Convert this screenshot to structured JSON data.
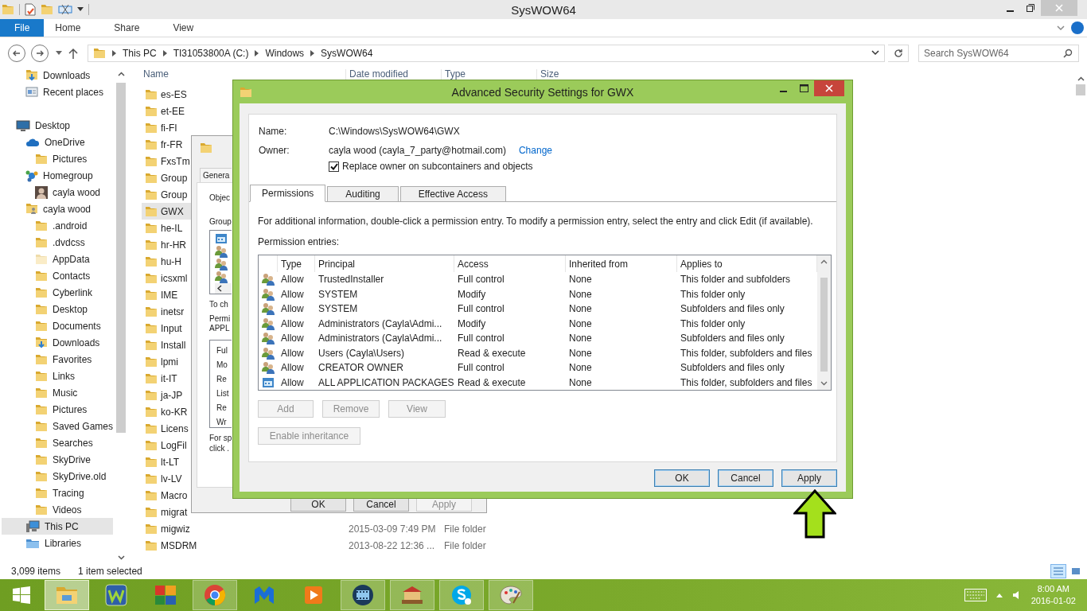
{
  "explorer": {
    "title": "SysWOW64",
    "ribbon_tabs": [
      {
        "label": "File",
        "kind": "file"
      },
      {
        "label": "Home",
        "kind": "tab"
      },
      {
        "label": "Share",
        "kind": "tab"
      },
      {
        "label": "View",
        "kind": "tab"
      }
    ],
    "breadcrumbs": [
      "This PC",
      "TI31053800A (C:)",
      "Windows",
      "SysWOW64"
    ],
    "search": {
      "placeholder": "Search SysWOW64"
    },
    "nav": {
      "pinned": [
        {
          "label": "Downloads",
          "kind": "download",
          "selected": false
        },
        {
          "label": "Recent places",
          "kind": "recent",
          "selected": false
        }
      ],
      "tree": [
        {
          "label": "Desktop",
          "kind": "desktop",
          "selected": false,
          "children": [
            {
              "label": "OneDrive",
              "kind": "cloud",
              "selected": false,
              "children": [
                {
                  "label": "Pictures",
                  "kind": "folder",
                  "selected": false
                }
              ]
            },
            {
              "label": "Homegroup",
              "kind": "homegroup",
              "selected": false,
              "children": [
                {
                  "label": "cayla wood",
                  "kind": "avatar",
                  "selected": false
                }
              ]
            },
            {
              "label": "cayla wood",
              "kind": "user",
              "selected": false,
              "children": [
                {
                  "label": ".android",
                  "kind": "folder",
                  "selected": false
                },
                {
                  "label": ".dvdcss",
                  "kind": "folder",
                  "selected": false
                },
                {
                  "label": "AppData",
                  "kind": "hidden",
                  "selected": false
                },
                {
                  "label": "Contacts",
                  "kind": "folder",
                  "selected": false
                },
                {
                  "label": "Cyberlink",
                  "kind": "folder",
                  "selected": false
                },
                {
                  "label": "Desktop",
                  "kind": "folder",
                  "selected": false
                },
                {
                  "label": "Documents",
                  "kind": "folder",
                  "selected": false
                },
                {
                  "label": "Downloads",
                  "kind": "download",
                  "selected": false
                },
                {
                  "label": "Favorites",
                  "kind": "folder",
                  "selected": false
                },
                {
                  "label": "Links",
                  "kind": "folder",
                  "selected": false
                },
                {
                  "label": "Music",
                  "kind": "folder",
                  "selected": false
                },
                {
                  "label": "Pictures",
                  "kind": "folder",
                  "selected": false
                },
                {
                  "label": "Saved Games",
                  "kind": "folder",
                  "selected": false
                },
                {
                  "label": "Searches",
                  "kind": "folder",
                  "selected": false
                },
                {
                  "label": "SkyDrive",
                  "kind": "folder",
                  "selected": false
                },
                {
                  "label": "SkyDrive.old",
                  "kind": "folder",
                  "selected": false
                },
                {
                  "label": "Tracing",
                  "kind": "folder",
                  "selected": false
                },
                {
                  "label": "Videos",
                  "kind": "folder",
                  "selected": false
                }
              ]
            },
            {
              "label": "This PC",
              "kind": "pc",
              "selected": true
            },
            {
              "label": "Libraries",
              "kind": "library",
              "selected": false
            }
          ]
        }
      ]
    },
    "columns": [
      "Name",
      "Date modified",
      "Type",
      "Size"
    ],
    "files": [
      {
        "name": "es-ES",
        "selected": false
      },
      {
        "name": "et-EE",
        "selected": false
      },
      {
        "name": "fi-FI",
        "selected": false
      },
      {
        "name": "fr-FR",
        "selected": false
      },
      {
        "name": "FxsTm",
        "selected": false
      },
      {
        "name": "Group",
        "selected": false
      },
      {
        "name": "Group",
        "selected": false
      },
      {
        "name": "GWX",
        "selected": true
      },
      {
        "name": "he-IL",
        "selected": false
      },
      {
        "name": "hr-HR",
        "selected": false
      },
      {
        "name": "hu-H",
        "selected": false
      },
      {
        "name": "icsxml",
        "selected": false
      },
      {
        "name": "IME",
        "selected": false
      },
      {
        "name": "inetsr",
        "selected": false
      },
      {
        "name": "Input",
        "selected": false
      },
      {
        "name": "Install",
        "selected": false
      },
      {
        "name": "lpmi",
        "selected": false
      },
      {
        "name": "it-IT",
        "selected": false
      },
      {
        "name": "ja-JP",
        "selected": false
      },
      {
        "name": "ko-KR",
        "selected": false
      },
      {
        "name": "Licens",
        "selected": false
      },
      {
        "name": "LogFil",
        "selected": false
      },
      {
        "name": "lt-LT",
        "selected": false
      },
      {
        "name": "lv-LV",
        "selected": false
      },
      {
        "name": "Macro",
        "selected": false
      },
      {
        "name": "migrat",
        "selected": false
      },
      {
        "name": "migwiz",
        "date": "2015-03-09 7:49 PM",
        "type": "File folder",
        "selected": false
      },
      {
        "name": "MSDRM",
        "date": "2013-08-22 12:36 ...",
        "type": "File folder",
        "selected": false
      }
    ],
    "status": {
      "count": "3,099 items",
      "selection": "1 item selected"
    }
  },
  "properties_dialog": {
    "tab": "Genera",
    "object_label": "Objec",
    "groups_label": "Group",
    "groups": [
      {
        "kind": "package"
      },
      {
        "kind": "group"
      },
      {
        "kind": "group"
      },
      {
        "kind": "group"
      }
    ],
    "change_hint": "To ch",
    "permissions_label": [
      "Permi",
      "APPL"
    ],
    "permissions": [
      "Ful",
      "Mo",
      "Re",
      "List",
      "Re",
      "Wr"
    ],
    "footer_text": [
      "For sp",
      "click ."
    ],
    "buttons": [
      {
        "label": "OK",
        "disabled": false
      },
      {
        "label": "Cancel",
        "disabled": false
      },
      {
        "label": "Apply",
        "disabled": true
      }
    ]
  },
  "advanced_dialog": {
    "title": "Advanced Security Settings for GWX",
    "name_label": "Name:",
    "name_value": "C:\\Windows\\SysWOW64\\GWX",
    "owner_label": "Owner:",
    "owner_value": "cayla wood (cayla_7_party@hotmail.com)",
    "owner_link": "Change",
    "replace_owner": {
      "label": "Replace owner on subcontainers and objects",
      "checked": true
    },
    "tabs": [
      {
        "label": "Permissions",
        "selected": true
      },
      {
        "label": "Auditing",
        "selected": false
      },
      {
        "label": "Effective Access",
        "selected": false
      }
    ],
    "info": "For additional information, double-click a permission entry. To modify a permission entry, select the entry and click Edit (if available).",
    "entries_label": "Permission entries:",
    "columns": [
      "Type",
      "Principal",
      "Access",
      "Inherited from",
      "Applies to"
    ],
    "entries": [
      {
        "kind": "group",
        "type": "Allow",
        "principal": "TrustedInstaller",
        "access": "Full control",
        "inherited": "None",
        "applies_to": "This folder and subfolders"
      },
      {
        "kind": "group",
        "type": "Allow",
        "principal": "SYSTEM",
        "access": "Modify",
        "inherited": "None",
        "applies_to": "This folder only"
      },
      {
        "kind": "group",
        "type": "Allow",
        "principal": "SYSTEM",
        "access": "Full control",
        "inherited": "None",
        "applies_to": "Subfolders and files only"
      },
      {
        "kind": "group",
        "type": "Allow",
        "principal": "Administrators (Cayla\\Admi...",
        "access": "Modify",
        "inherited": "None",
        "applies_to": "This folder only"
      },
      {
        "kind": "group",
        "type": "Allow",
        "principal": "Administrators (Cayla\\Admi...",
        "access": "Full control",
        "inherited": "None",
        "applies_to": "Subfolders and files only"
      },
      {
        "kind": "group",
        "type": "Allow",
        "principal": "Users (Cayla\\Users)",
        "access": "Read & execute",
        "inherited": "None",
        "applies_to": "This folder, subfolders and files"
      },
      {
        "kind": "group",
        "type": "Allow",
        "principal": "CREATOR OWNER",
        "access": "Full control",
        "inherited": "None",
        "applies_to": "Subfolders and files only"
      },
      {
        "kind": "package",
        "type": "Allow",
        "principal": "ALL APPLICATION PACKAGES",
        "access": "Read & execute",
        "inherited": "None",
        "applies_to": "This folder, subfolders and files"
      }
    ],
    "entry_buttons": [
      {
        "label": "Add",
        "disabled": true
      },
      {
        "label": "Remove",
        "disabled": true
      },
      {
        "label": "View",
        "disabled": true
      }
    ],
    "inheritance_button": {
      "label": "Enable inheritance",
      "disabled": true
    },
    "buttons": [
      {
        "label": "OK",
        "disabled": false
      },
      {
        "label": "Cancel",
        "disabled": false
      },
      {
        "label": "Apply",
        "disabled": false
      }
    ]
  },
  "taskbar": {
    "apps": [
      {
        "kind": "explorer",
        "running": true,
        "active": true
      },
      {
        "kind": "wordweb",
        "running": false,
        "active": false
      },
      {
        "kind": "avg",
        "running": false,
        "active": false
      },
      {
        "kind": "chrome",
        "running": true,
        "active": false
      },
      {
        "kind": "malwarebytes",
        "running": false,
        "active": false
      },
      {
        "kind": "player",
        "running": false,
        "active": false
      },
      {
        "kind": "film",
        "running": true,
        "active": false
      },
      {
        "kind": "fair",
        "running": true,
        "active": false
      },
      {
        "kind": "skype",
        "running": true,
        "active": false
      },
      {
        "kind": "paint",
        "running": true,
        "active": false
      }
    ],
    "time": "8:00 AM",
    "date": "2016-01-02"
  }
}
